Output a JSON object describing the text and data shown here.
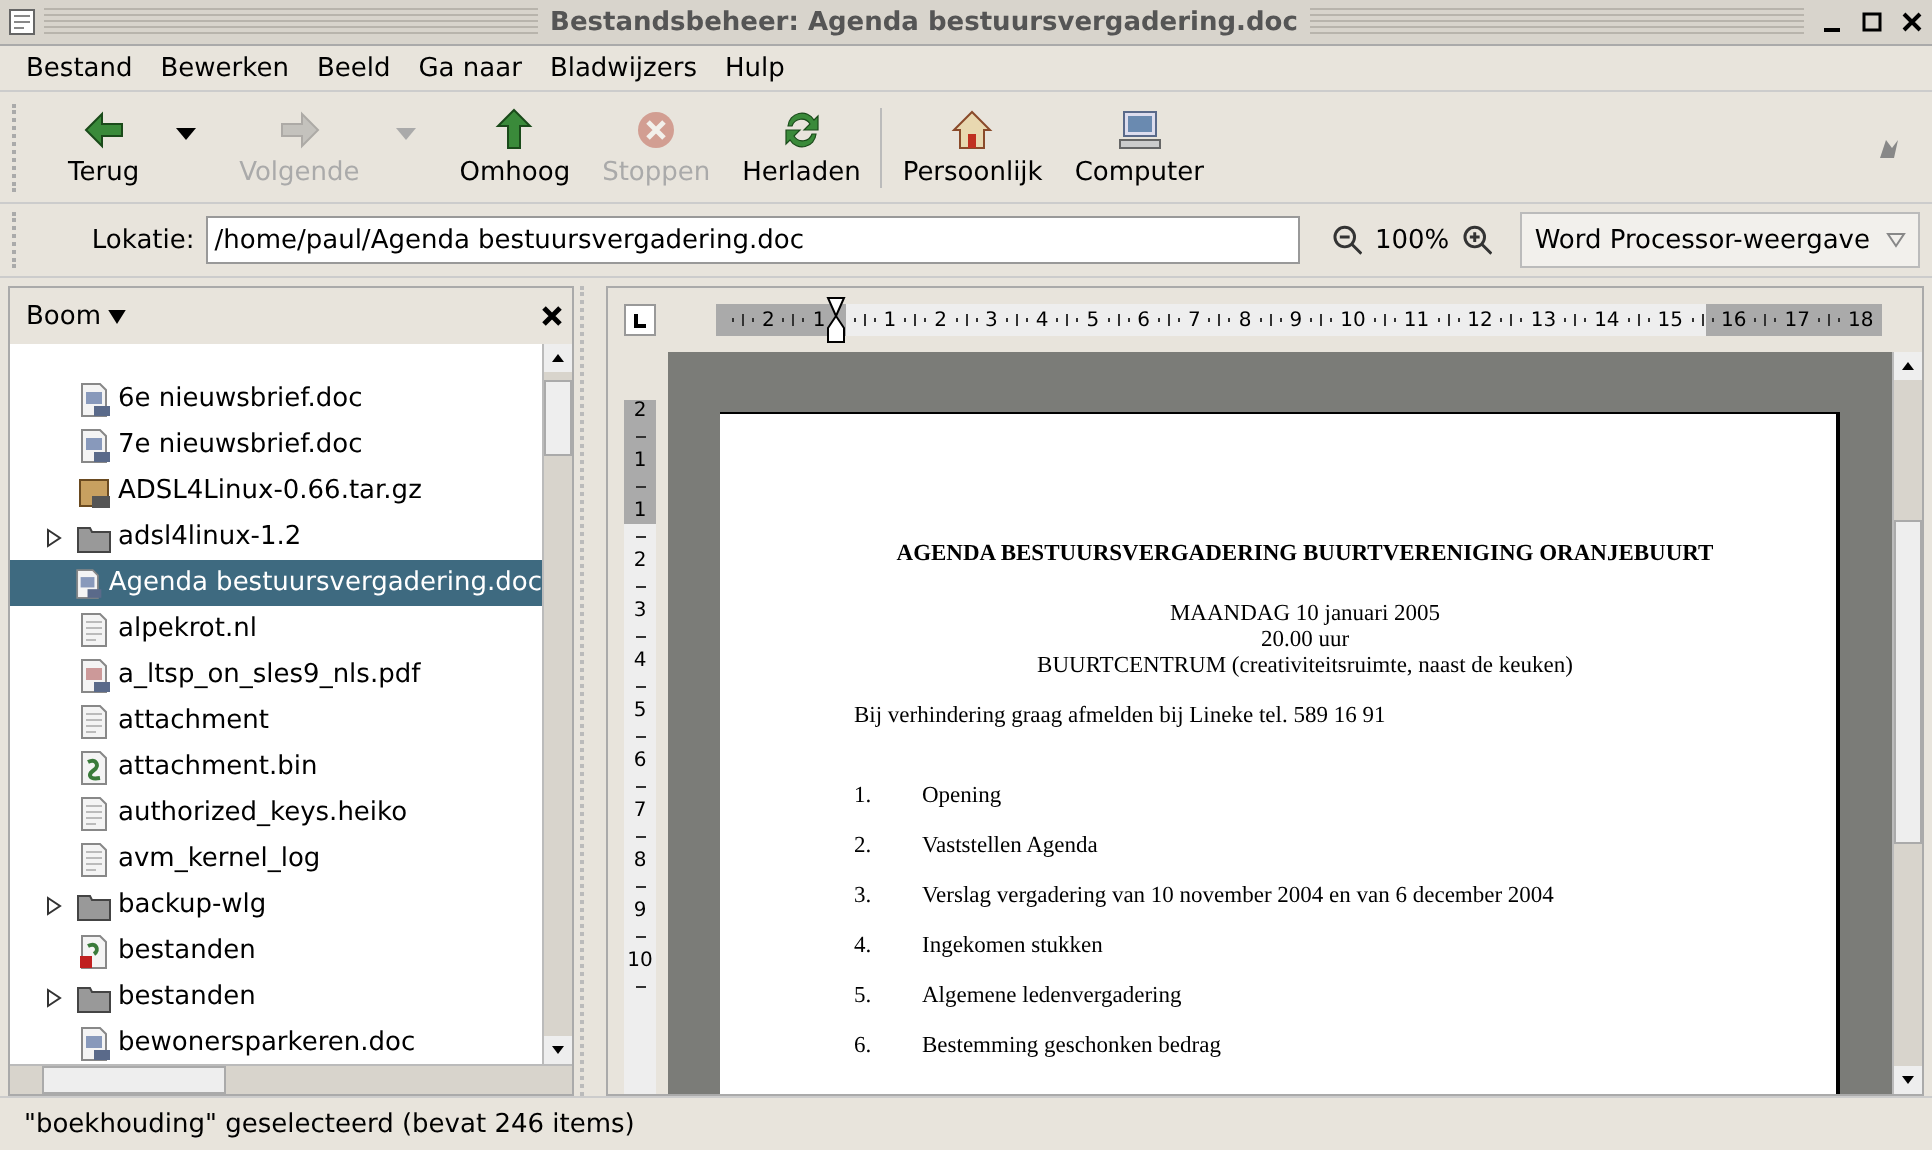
{
  "window": {
    "title": "Bestandsbeheer: Agenda bestuursvergadering.doc"
  },
  "menu": [
    "Bestand",
    "Bewerken",
    "Beeld",
    "Ga naar",
    "Bladwijzers",
    "Hulp"
  ],
  "toolbar": [
    {
      "kind": "back",
      "label": "Terug",
      "disabled": false,
      "dropdown": true
    },
    {
      "kind": "forward",
      "label": "Volgende",
      "disabled": true,
      "dropdown": true
    },
    {
      "kind": "up",
      "label": "Omhoog",
      "disabled": false,
      "dropdown": false
    },
    {
      "kind": "stop",
      "label": "Stoppen",
      "disabled": true,
      "dropdown": false
    },
    {
      "kind": "reload",
      "label": "Herladen",
      "disabled": false,
      "dropdown": false
    },
    {
      "kind": "home",
      "label": "Persoonlijk",
      "disabled": false,
      "dropdown": false
    },
    {
      "kind": "computer",
      "label": "Computer",
      "disabled": false,
      "dropdown": false
    }
  ],
  "location": {
    "label": "Lokatie:",
    "value": "/home/paul/Agenda bestuursvergadering.doc",
    "zoom": "100%",
    "view": "Word Processor-weergave"
  },
  "sidebar": {
    "title": "Boom",
    "items": [
      {
        "name": "6e nieuwsbrief.doc",
        "kind": "doc",
        "expandable": false,
        "selected": false
      },
      {
        "name": "7e nieuwsbrief.doc",
        "kind": "doc",
        "expandable": false,
        "selected": false
      },
      {
        "name": "ADSL4Linux-0.66.tar.gz",
        "kind": "archive",
        "expandable": false,
        "selected": false
      },
      {
        "name": "adsl4linux-1.2",
        "kind": "folder",
        "expandable": true,
        "selected": false
      },
      {
        "name": "Agenda bestuursvergadering.doc",
        "kind": "doc",
        "expandable": false,
        "selected": true
      },
      {
        "name": "alpekrot.nl",
        "kind": "text",
        "expandable": false,
        "selected": false
      },
      {
        "name": "a_ltsp_on_sles9_nls.pdf",
        "kind": "pdf",
        "expandable": false,
        "selected": false
      },
      {
        "name": "attachment",
        "kind": "text",
        "expandable": false,
        "selected": false
      },
      {
        "name": "attachment.bin",
        "kind": "binary",
        "expandable": false,
        "selected": false
      },
      {
        "name": "authorized_keys.heiko",
        "kind": "text",
        "expandable": false,
        "selected": false
      },
      {
        "name": "avm_kernel_log",
        "kind": "text",
        "expandable": false,
        "selected": false
      },
      {
        "name": "backup-wlg",
        "kind": "folder",
        "expandable": true,
        "selected": false
      },
      {
        "name": "bestanden",
        "kind": "script",
        "expandable": false,
        "selected": false
      },
      {
        "name": "bestanden",
        "kind": "folder",
        "expandable": true,
        "selected": false
      },
      {
        "name": "bewonersparkeren.doc",
        "kind": "doc",
        "expandable": false,
        "selected": false
      }
    ]
  },
  "ruler": {
    "horizontal": [
      "2",
      "1",
      "1",
      "2",
      "3",
      "4",
      "5",
      "6",
      "7",
      "8",
      "9",
      "10",
      "11",
      "12",
      "13",
      "14",
      "15",
      "16",
      "17",
      "18"
    ],
    "vertical": [
      "2",
      "1",
      "1",
      "2",
      "3",
      "4",
      "5",
      "6",
      "7",
      "8",
      "9",
      "10"
    ]
  },
  "document": {
    "title": "AGENDA BESTUURSVERGADERING BUURTVERENIGING ORANJEBUURT",
    "subtitle_lines": [
      "MAANDAG 10 januari 2005",
      "20.00 uur",
      "BUURTCENTRUM (creativiteitsruimte, naast de keuken)"
    ],
    "notice": "Bij verhindering graag afmelden bij Lineke tel. 589 16 91",
    "items": [
      {
        "number": "1.",
        "text": "Opening"
      },
      {
        "number": "2.",
        "text": "Vaststellen Agenda"
      },
      {
        "number": "3.",
        "text": "Verslag vergadering van 10 november 2004 en van 6 december 2004"
      },
      {
        "number": "4.",
        "text": "Ingekomen stukken"
      },
      {
        "number": "5.",
        "text": "Algemene ledenvergadering"
      },
      {
        "number": "6.",
        "text": "Bestemming geschonken bedrag"
      }
    ]
  },
  "status_bar": "\"boekhouding\" geselecteerd (bevat 246 items)"
}
